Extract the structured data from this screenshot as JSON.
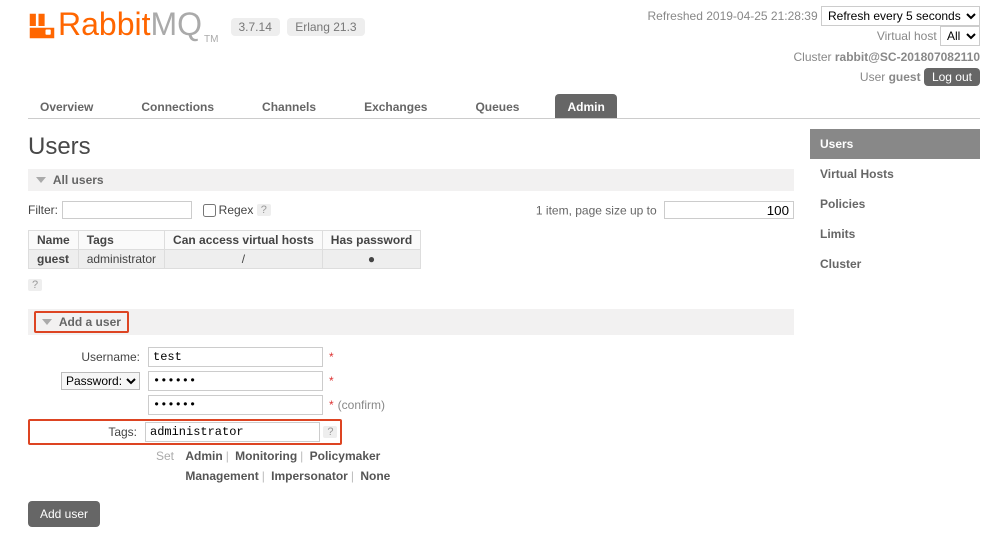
{
  "header": {
    "logo1": "Rabbit",
    "logo2": "MQ",
    "tm": "TM",
    "version": "3.7.14",
    "erlang": "Erlang 21.3",
    "refreshed": "Refreshed 2019-04-25 21:28:39",
    "refresh_option": "Refresh every 5 seconds",
    "vhost_label": "Virtual host",
    "vhost_option": "All",
    "cluster_label": "Cluster",
    "cluster_value": "rabbit@SC-201807082110",
    "user_label": "User",
    "user_value": "guest",
    "logout": "Log out"
  },
  "tabs": [
    "Overview",
    "Connections",
    "Channels",
    "Exchanges",
    "Queues",
    "Admin"
  ],
  "sidebar": [
    "Users",
    "Virtual Hosts",
    "Policies",
    "Limits",
    "Cluster"
  ],
  "page": {
    "title": "Users",
    "section_all": "All users",
    "filter_label": "Filter:",
    "regex_label": "Regex",
    "help": "?",
    "pager_prefix": "1 item, page size up to",
    "page_size": "100"
  },
  "table": {
    "headers": [
      "Name",
      "Tags",
      "Can access virtual hosts",
      "Has password"
    ],
    "row": {
      "name": "guest",
      "tags": "administrator",
      "vhost": "/",
      "password": "●"
    }
  },
  "add": {
    "title": "Add a user",
    "username_label": "Username:",
    "username_value": "test",
    "password_option": "Password:",
    "confirm": "(confirm)",
    "tags_label": "Tags:",
    "tags_value": "administrator",
    "set_label": "Set",
    "quick_tags": [
      "Admin",
      "Monitoring",
      "Policymaker",
      "Management",
      "Impersonator",
      "None"
    ],
    "submit": "Add user",
    "asterisk": "*"
  }
}
